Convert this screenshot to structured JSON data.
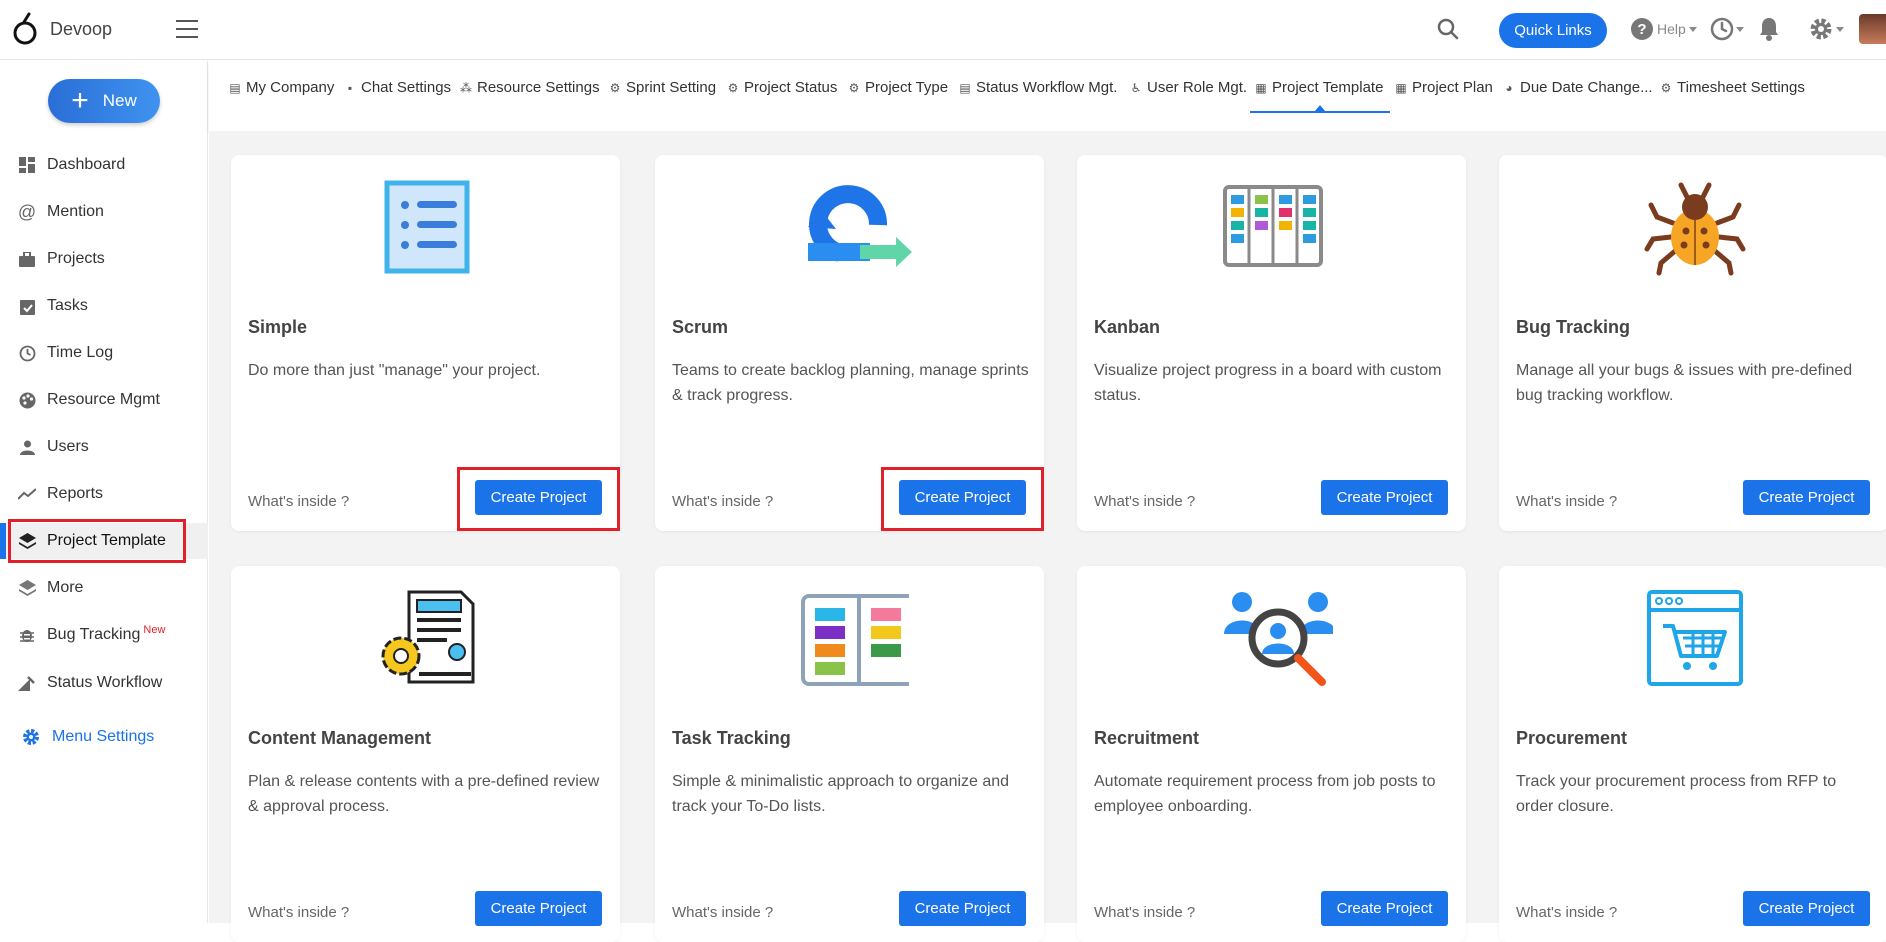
{
  "app": {
    "name": "Devoop"
  },
  "topbar": {
    "quick_links": "Quick Links",
    "help": "Help"
  },
  "sidebar": {
    "new_label": "New",
    "items": [
      {
        "label": "Dashboard",
        "icon": "dashboard-icon"
      },
      {
        "label": "Mention",
        "icon": "at-icon"
      },
      {
        "label": "Projects",
        "icon": "briefcase-icon"
      },
      {
        "label": "Tasks",
        "icon": "clipboard-check-icon"
      },
      {
        "label": "Time Log",
        "icon": "clock-icon"
      },
      {
        "label": "Resource Mgmt",
        "icon": "palette-icon"
      },
      {
        "label": "Users",
        "icon": "user-icon"
      },
      {
        "label": "Reports",
        "icon": "trend-icon"
      },
      {
        "label": "Project Template",
        "icon": "layers-icon"
      },
      {
        "label": "More",
        "icon": "layers-icon"
      },
      {
        "label": "Bug Tracking",
        "icon": "bug-icon",
        "badge": "New"
      },
      {
        "label": "Status Workflow",
        "icon": "workflow-icon"
      }
    ],
    "menu_settings": "Menu Settings"
  },
  "tabs": [
    "My Company",
    "Chat Settings",
    "Resource Settings",
    "Sprint Setting",
    "Project Status",
    "Project Type",
    "Status Workflow Mgt.",
    "User Role Mgt.",
    "Project Template",
    "Project Plan",
    "Due Date Change...",
    "Timesheet Settings"
  ],
  "cards": [
    {
      "title": "Simple",
      "desc": "Do more than just \"manage\" your project.",
      "inside": "What's inside ?",
      "button": "Create Project"
    },
    {
      "title": "Scrum",
      "desc": "Teams to create backlog planning, manage sprints & track progress.",
      "inside": "What's inside ?",
      "button": "Create Project"
    },
    {
      "title": "Kanban",
      "desc": "Visualize project progress in a board with custom status.",
      "inside": "What's inside ?",
      "button": "Create Project"
    },
    {
      "title": "Bug Tracking",
      "desc": "Manage all your bugs & issues with pre-defined bug tracking workflow.",
      "inside": "What's inside ?",
      "button": "Create Project"
    },
    {
      "title": "Content Management",
      "desc": "Plan & release contents with a pre-defined review & approval process.",
      "inside": "What's inside ?",
      "button": "Create Project"
    },
    {
      "title": "Task Tracking",
      "desc": "Simple & minimalistic approach to organize and track your To-Do lists.",
      "inside": "What's inside ?",
      "button": "Create Project"
    },
    {
      "title": "Recruitment",
      "desc": "Automate requirement process from job posts to employee onboarding.",
      "inside": "What's inside ?",
      "button": "Create Project"
    },
    {
      "title": "Procurement",
      "desc": "Track your procurement process from RFP to order closure.",
      "inside": "What's inside ?",
      "button": "Create Project"
    }
  ],
  "colors": {
    "accent": "#1a73e8",
    "highlight": "#e0202b"
  }
}
